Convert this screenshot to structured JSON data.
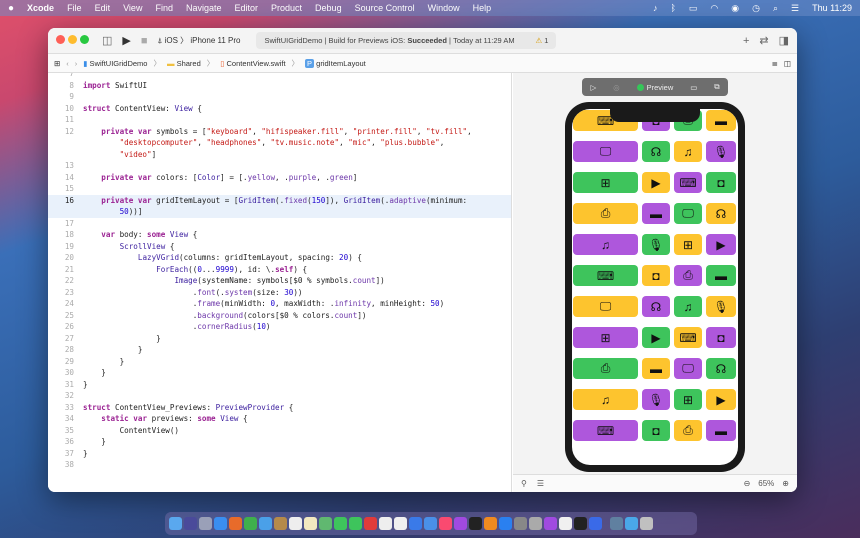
{
  "menubar": {
    "app": "Xcode",
    "items": [
      "File",
      "Edit",
      "View",
      "Find",
      "Navigate",
      "Editor",
      "Product",
      "Debug",
      "Source Control",
      "Window",
      "Help"
    ],
    "clock": "Thu 11:29"
  },
  "toolbar": {
    "platform": "iOS",
    "device": "iPhone 11 Pro",
    "status_project": "SwiftUIGridDemo",
    "status_text": "Build for Previews iOS:",
    "status_result": "Succeeded",
    "status_time": "Today at 11:29 AM",
    "warning_count": "1"
  },
  "breadcrumb": [
    "SwiftUIGridDemo",
    "Shared",
    "ContentView.swift",
    "gridItemLayout"
  ],
  "code": [
    {
      "n": "7",
      "p": []
    },
    {
      "n": "8",
      "p": [
        [
          "kw",
          "import"
        ],
        [
          "pl",
          " SwiftUI"
        ]
      ]
    },
    {
      "n": "9",
      "p": []
    },
    {
      "n": "10",
      "p": [
        [
          "kw",
          "struct"
        ],
        [
          "pl",
          " ContentView: "
        ],
        [
          "ty",
          "View"
        ],
        [
          "pl",
          " {"
        ]
      ]
    },
    {
      "n": "11",
      "p": []
    },
    {
      "n": "12",
      "p": [
        [
          "pl",
          "    "
        ],
        [
          "kw",
          "private var"
        ],
        [
          "pl",
          " symbols = ["
        ],
        [
          "st",
          "\"keyboard\""
        ],
        [
          "pl",
          ", "
        ],
        [
          "st",
          "\"hifispeaker.fill\""
        ],
        [
          "pl",
          ", "
        ],
        [
          "st",
          "\"printer.fill\""
        ],
        [
          "pl",
          ", "
        ],
        [
          "st",
          "\"tv.fill\""
        ],
        [
          "pl",
          ","
        ]
      ]
    },
    {
      "n": "",
      "p": [
        [
          "pl",
          "        "
        ],
        [
          "st",
          "\"desktopcomputer\""
        ],
        [
          "pl",
          ", "
        ],
        [
          "st",
          "\"headphones\""
        ],
        [
          "pl",
          ", "
        ],
        [
          "st",
          "\"tv.music.note\""
        ],
        [
          "pl",
          ", "
        ],
        [
          "st",
          "\"mic\""
        ],
        [
          "pl",
          ", "
        ],
        [
          "st",
          "\"plus.bubble\""
        ],
        [
          "pl",
          ","
        ]
      ]
    },
    {
      "n": "",
      "p": [
        [
          "pl",
          "        "
        ],
        [
          "st",
          "\"video\""
        ],
        [
          "pl",
          "]"
        ]
      ]
    },
    {
      "n": "13",
      "p": []
    },
    {
      "n": "14",
      "p": [
        [
          "pl",
          "    "
        ],
        [
          "kw",
          "private var"
        ],
        [
          "pl",
          " colors: ["
        ],
        [
          "ty",
          "Color"
        ],
        [
          "pl",
          "] = [."
        ],
        [
          "fn",
          "yellow"
        ],
        [
          "pl",
          ", ."
        ],
        [
          "fn",
          "purple"
        ],
        [
          "pl",
          ", ."
        ],
        [
          "fn",
          "green"
        ],
        [
          "pl",
          "]"
        ]
      ]
    },
    {
      "n": "15",
      "p": []
    },
    {
      "n": "16",
      "hl": true,
      "p": [
        [
          "pl",
          "    "
        ],
        [
          "kw",
          "private var"
        ],
        [
          "pl",
          " gridItemLayout = ["
        ],
        [
          "ty",
          "GridItem"
        ],
        [
          "pl",
          "(."
        ],
        [
          "fn",
          "fixed"
        ],
        [
          "pl",
          "("
        ],
        [
          "nu",
          "150"
        ],
        [
          "pl",
          "]), "
        ],
        [
          "ty",
          "GridItem"
        ],
        [
          "pl",
          "(."
        ],
        [
          "fn",
          "adaptive"
        ],
        [
          "pl",
          "(minimum:"
        ]
      ]
    },
    {
      "n": "",
      "hl": true,
      "p": [
        [
          "pl",
          "        "
        ],
        [
          "nu",
          "50"
        ],
        [
          "pl",
          "))]"
        ]
      ]
    },
    {
      "n": "17",
      "p": []
    },
    {
      "n": "18",
      "p": [
        [
          "pl",
          "    "
        ],
        [
          "kw",
          "var"
        ],
        [
          "pl",
          " body: "
        ],
        [
          "kw",
          "some"
        ],
        [
          "pl",
          " "
        ],
        [
          "ty",
          "View"
        ],
        [
          "pl",
          " {"
        ]
      ]
    },
    {
      "n": "19",
      "p": [
        [
          "pl",
          "        "
        ],
        [
          "ty",
          "ScrollView"
        ],
        [
          "pl",
          " {"
        ]
      ]
    },
    {
      "n": "20",
      "p": [
        [
          "pl",
          "            "
        ],
        [
          "ty",
          "LazyVGrid"
        ],
        [
          "pl",
          "(columns: gridItemLayout, spacing: "
        ],
        [
          "nu",
          "20"
        ],
        [
          "pl",
          ") {"
        ]
      ]
    },
    {
      "n": "21",
      "p": [
        [
          "pl",
          "                "
        ],
        [
          "ty",
          "ForEach"
        ],
        [
          "pl",
          "(("
        ],
        [
          "nu",
          "0"
        ],
        [
          "pl",
          "..."
        ],
        [
          "nu",
          "9999"
        ],
        [
          "pl",
          "), id: \\."
        ],
        [
          "kw",
          "self"
        ],
        [
          "pl",
          ") {"
        ]
      ]
    },
    {
      "n": "22",
      "p": [
        [
          "pl",
          "                    "
        ],
        [
          "ty",
          "Image"
        ],
        [
          "pl",
          "(systemName: symbols[$0 % symbols."
        ],
        [
          "fn",
          "count"
        ],
        [
          "pl",
          "])"
        ]
      ]
    },
    {
      "n": "23",
      "p": [
        [
          "pl",
          "                        ."
        ],
        [
          "fn",
          "font"
        ],
        [
          "pl",
          "(."
        ],
        [
          "fn",
          "system"
        ],
        [
          "pl",
          "(size: "
        ],
        [
          "nu",
          "30"
        ],
        [
          "pl",
          "))"
        ]
      ]
    },
    {
      "n": "24",
      "p": [
        [
          "pl",
          "                        ."
        ],
        [
          "fn",
          "frame"
        ],
        [
          "pl",
          "(minWidth: "
        ],
        [
          "nu",
          "0"
        ],
        [
          "pl",
          ", maxWidth: ."
        ],
        [
          "fn",
          "infinity"
        ],
        [
          "pl",
          ", minHeight: "
        ],
        [
          "nu",
          "50"
        ],
        [
          "pl",
          ")"
        ]
      ]
    },
    {
      "n": "25",
      "p": [
        [
          "pl",
          "                        ."
        ],
        [
          "fn",
          "background"
        ],
        [
          "pl",
          "(colors[$0 % colors."
        ],
        [
          "fn",
          "count"
        ],
        [
          "pl",
          "])"
        ]
      ]
    },
    {
      "n": "26",
      "p": [
        [
          "pl",
          "                        ."
        ],
        [
          "fn",
          "cornerRadius"
        ],
        [
          "pl",
          "("
        ],
        [
          "nu",
          "10"
        ],
        [
          "pl",
          ")"
        ]
      ]
    },
    {
      "n": "27",
      "p": [
        [
          "pl",
          "                }"
        ]
      ]
    },
    {
      "n": "28",
      "p": [
        [
          "pl",
          "            }"
        ]
      ]
    },
    {
      "n": "29",
      "p": [
        [
          "pl",
          "        }"
        ]
      ]
    },
    {
      "n": "30",
      "p": [
        [
          "pl",
          "    }"
        ]
      ]
    },
    {
      "n": "31",
      "p": [
        [
          "pl",
          "}"
        ]
      ]
    },
    {
      "n": "32",
      "p": []
    },
    {
      "n": "33",
      "p": [
        [
          "kw",
          "struct"
        ],
        [
          "pl",
          " ContentView_Previews: "
        ],
        [
          "ty",
          "PreviewProvider"
        ],
        [
          "pl",
          " {"
        ]
      ]
    },
    {
      "n": "34",
      "p": [
        [
          "pl",
          "    "
        ],
        [
          "kw",
          "static var"
        ],
        [
          "pl",
          " previews: "
        ],
        [
          "kw",
          "some"
        ],
        [
          "pl",
          " "
        ],
        [
          "ty",
          "View"
        ],
        [
          "pl",
          " {"
        ]
      ]
    },
    {
      "n": "35",
      "p": [
        [
          "pl",
          "        ContentView()"
        ]
      ]
    },
    {
      "n": "36",
      "p": [
        [
          "pl",
          "    }"
        ]
      ]
    },
    {
      "n": "37",
      "p": [
        [
          "pl",
          "}"
        ]
      ]
    },
    {
      "n": "38",
      "p": []
    }
  ],
  "preview": {
    "label": "Preview",
    "zoom": "65%",
    "symbols": [
      "keyboard",
      "hifispeaker.fill",
      "printer.fill",
      "tv.fill",
      "desktopcomputer",
      "headphones",
      "tv.music.note",
      "mic",
      "plus.bubble",
      "video"
    ],
    "glyphs": [
      "⌨",
      "◘",
      "⎙",
      "▬",
      "🖵",
      "☊",
      "♫",
      "🎙",
      "⊞",
      "▶"
    ],
    "colors": [
      "#fdc42e",
      "#ae57dc",
      "#3ec45c"
    ],
    "tile_count": 44
  },
  "dock": {
    "colors": [
      "#5aa8ee",
      "#4a4a9a",
      "#9aa0b8",
      "#3a8ef0",
      "#e86b2a",
      "#3fb04c",
      "#4aa0e8",
      "#b58a4a",
      "#eeeeee",
      "#f2e8c0",
      "#60b870",
      "#3ec45c",
      "#3ec45c",
      "#e03b3b",
      "#eeeeee",
      "#f0f0f0",
      "#3a7ae8",
      "#4a90e8",
      "#fa4a70",
      "#a04ae0",
      "#222222",
      "#f08a20",
      "#2a80f0",
      "#888888",
      "#aaaaaa",
      "#a04ae0",
      "#f0f0f0",
      "#222222",
      "#3a6ae8",
      "#6080a0",
      "#4aa8e8",
      "#c0c0c0"
    ]
  }
}
